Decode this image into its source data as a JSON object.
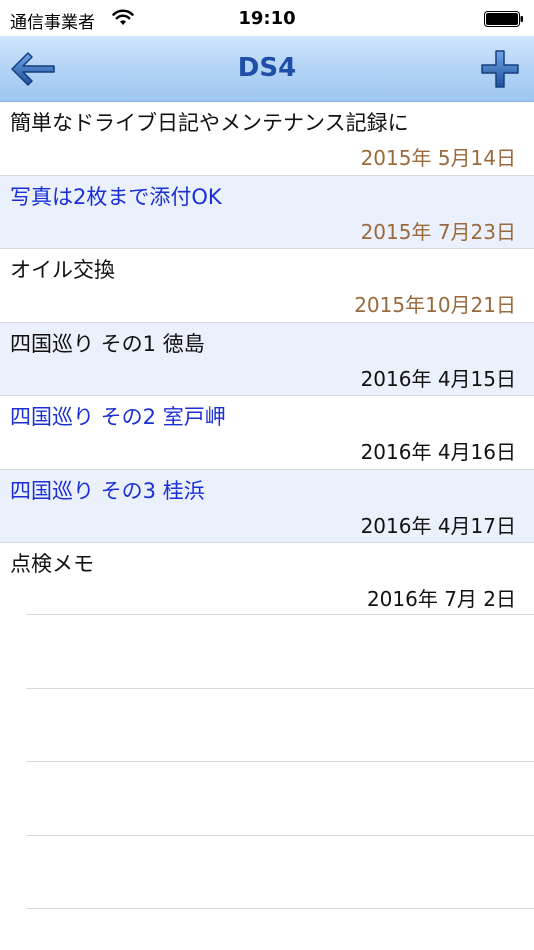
{
  "status": {
    "carrier": "通信事業者",
    "time": "19:10"
  },
  "nav": {
    "title": "DS4",
    "back_icon": "arrow-left-icon",
    "add_icon": "plus-icon",
    "accent_color": "#1f4ea8"
  },
  "entries": [
    {
      "title": "簡単なドライブ日記やメンテナンス記録に",
      "date": "2015年 5月14日"
    },
    {
      "title": "写真は2枚まで添付OK",
      "date": "2015年 7月23日"
    },
    {
      "title": "オイル交換",
      "date": "2015年10月21日"
    },
    {
      "title": "四国巡り その1 徳島",
      "date": "2016年 4月15日"
    },
    {
      "title": "四国巡り その2 室戸岬",
      "date": "2016年 4月16日"
    },
    {
      "title": "四国巡り その3 桂浜",
      "date": "2016年 4月17日"
    },
    {
      "title": "点検メモ",
      "date": "2016年 7月 2日"
    }
  ],
  "colors": {
    "blue_title": "#1a2fd4",
    "old_date": "#9a6a3c",
    "alt_row": "#eaf0fc"
  }
}
